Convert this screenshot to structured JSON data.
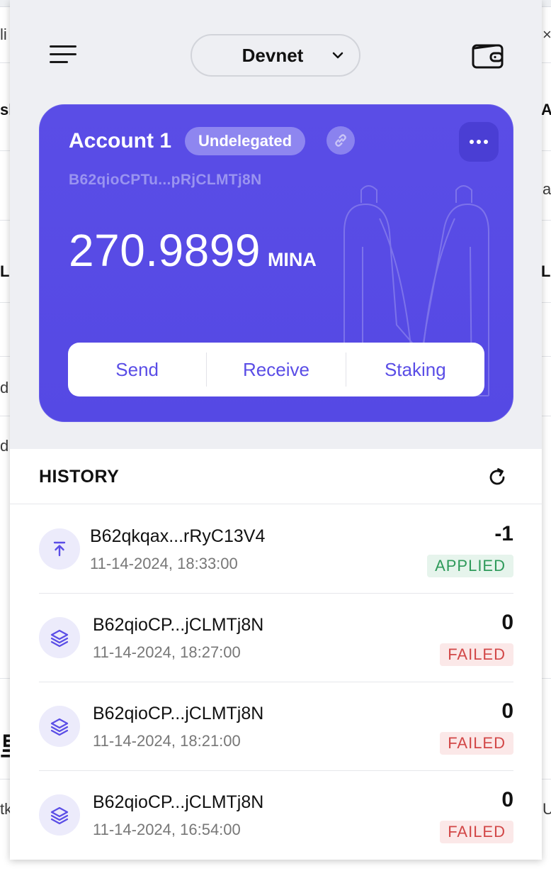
{
  "background_page": {
    "fragments": [
      "li",
      "×",
      "sk",
      "Ac",
      "ag",
      "La",
      "La",
      "d",
      "d",
      "里",
      "tk",
      "U"
    ]
  },
  "header": {
    "network": "Devnet",
    "icons": {
      "menu": "hamburger-menu-icon",
      "network_dropdown": "chevron-down-icon",
      "wallet": "wallet-icon"
    }
  },
  "account": {
    "name": "Account 1",
    "status": "Undelegated",
    "address": "B62qioCPTu...pRjCLMTj8N",
    "balance": "270.9899",
    "unit": "MINA",
    "actions": {
      "send": "Send",
      "receive": "Receive",
      "staking": "Staking"
    },
    "colors": {
      "card": "#5a4de6",
      "accent": "#5a4de6"
    }
  },
  "history": {
    "title": "HISTORY",
    "items": [
      {
        "icon": "send-arrow-up-icon",
        "address": "B62qkqax...rRyC13V4",
        "time": "11-14-2024, 18:33:00",
        "amount": "-1",
        "status": "APPLIED"
      },
      {
        "icon": "layers-stack-icon",
        "address": "B62qioCP...jCLMTj8N",
        "time": "11-14-2024, 18:27:00",
        "amount": "0",
        "status": "FAILED"
      },
      {
        "icon": "layers-stack-icon",
        "address": "B62qioCP...jCLMTj8N",
        "time": "11-14-2024, 18:21:00",
        "amount": "0",
        "status": "FAILED"
      },
      {
        "icon": "layers-stack-icon",
        "address": "B62qioCP...jCLMTj8N",
        "time": "11-14-2024, 16:54:00",
        "amount": "0",
        "status": "FAILED"
      }
    ],
    "status_colors": {
      "applied": "#2e9a5a",
      "failed": "#d24747"
    }
  }
}
